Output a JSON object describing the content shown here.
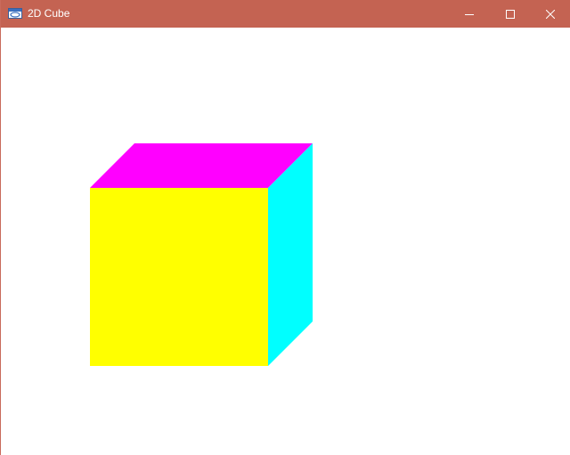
{
  "window": {
    "title": "2D Cube",
    "app_icon": "window-app-icon",
    "titlebar_color": "#c46352"
  },
  "controls": {
    "minimize_icon": "minimize-icon",
    "maximize_icon": "maximize-icon",
    "close_icon": "close-icon"
  },
  "cube": {
    "front_face_color": "#ffff00",
    "top_face_color": "#ff00ff",
    "side_face_color": "#00ffff"
  }
}
